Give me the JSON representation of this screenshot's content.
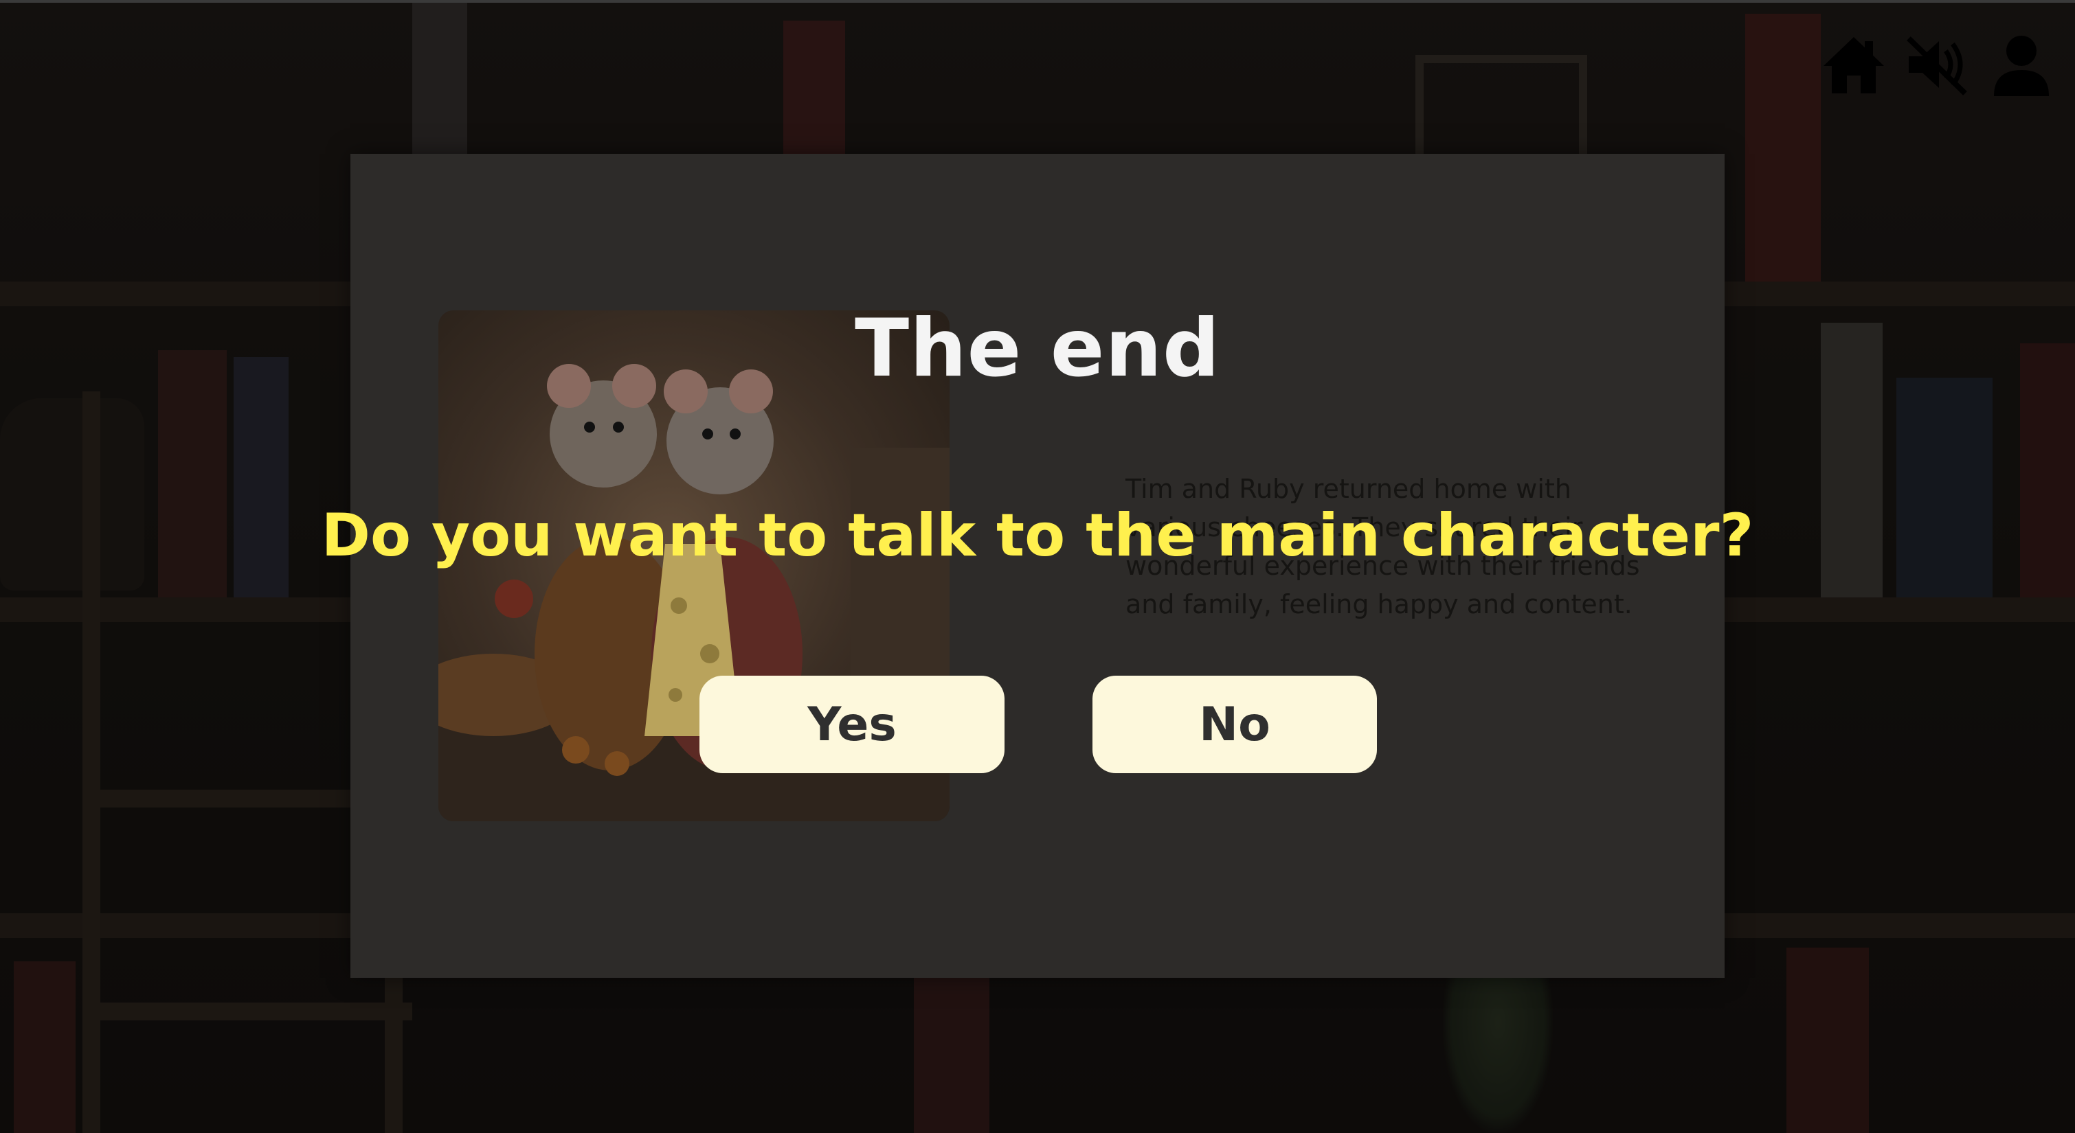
{
  "story": {
    "text": "Tim and Ruby returned home with various cheeses. They shared their wonderful experience with their friends and family, feeling happy and content."
  },
  "modal": {
    "title": "The end",
    "question": "Do you want to talk to the main character?",
    "yes_label": "Yes",
    "no_label": "No"
  },
  "nav": {
    "icons": [
      "home-icon",
      "speaker-muted-icon",
      "user-icon"
    ]
  },
  "colors": {
    "question_text": "#fff04e",
    "button_bg": "#fdf8dc",
    "title_text": "#f4f4f4"
  }
}
